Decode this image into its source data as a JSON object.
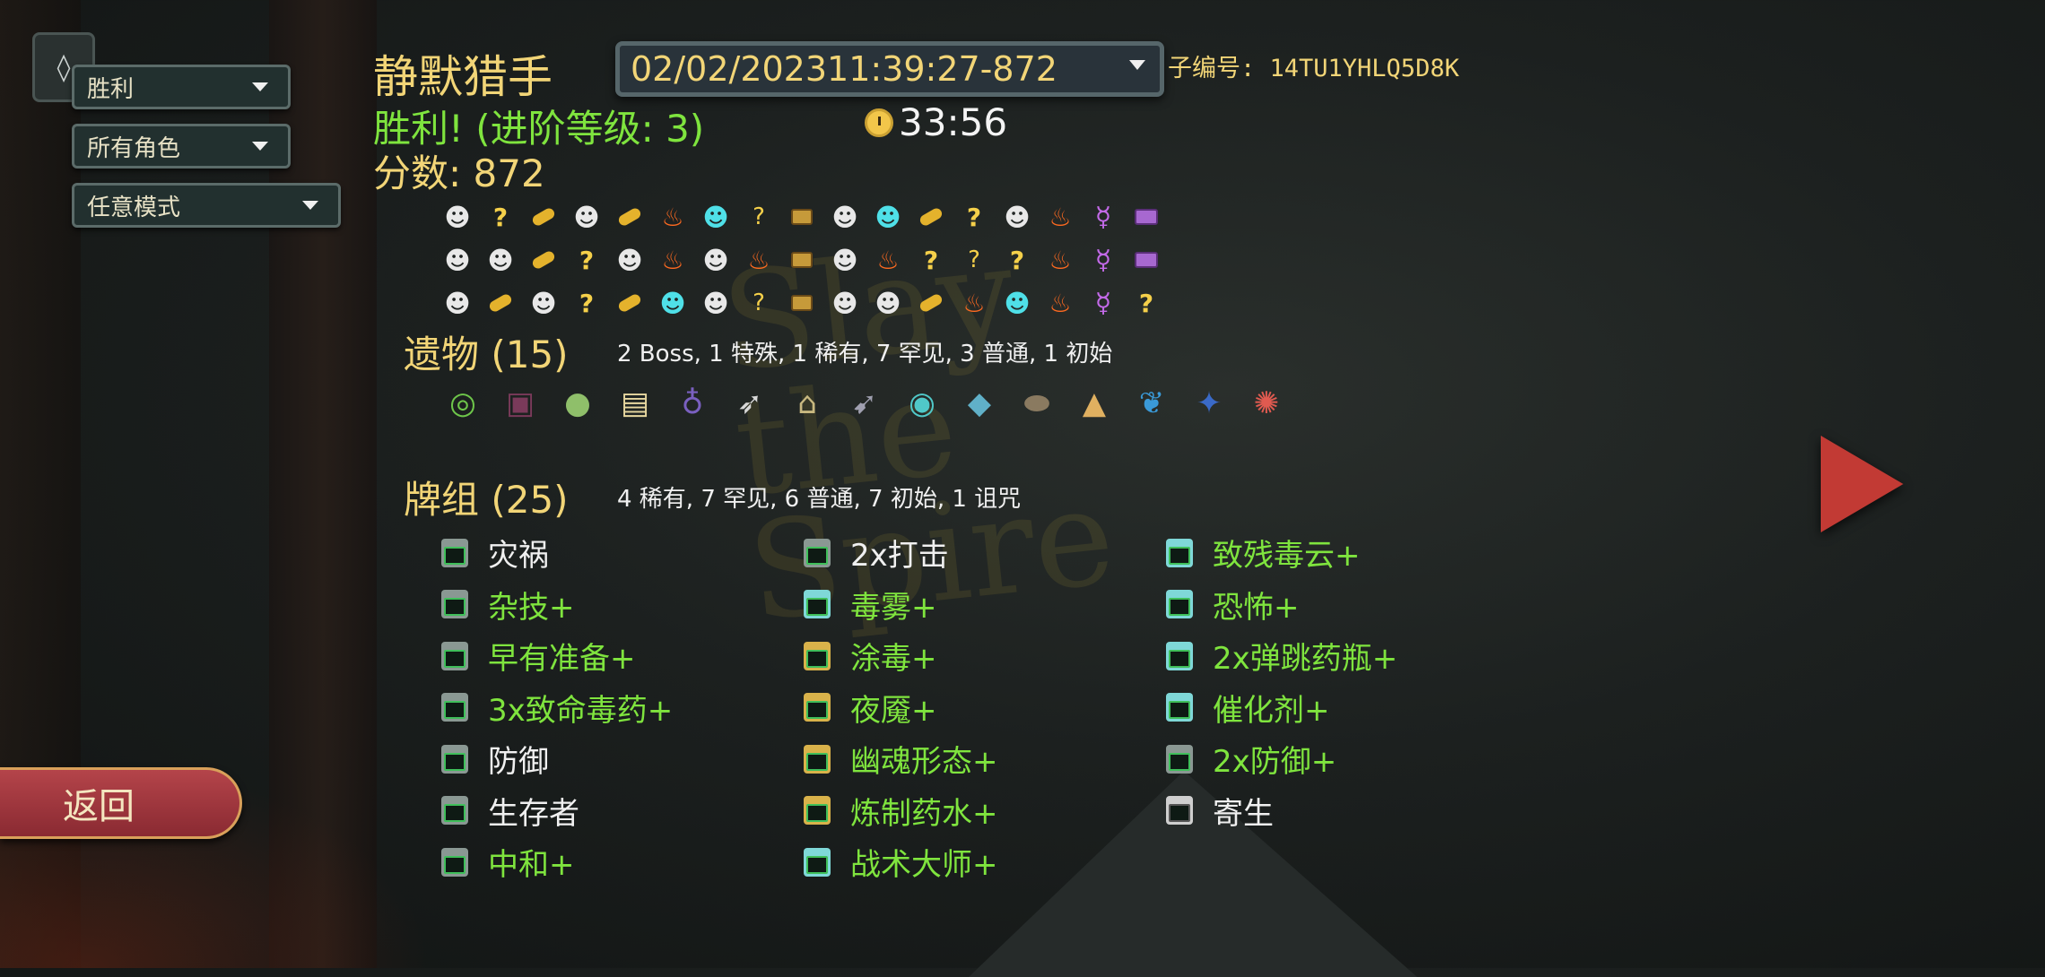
{
  "filters": {
    "result": "胜利",
    "character": "所有角色",
    "mode": "任意模式"
  },
  "run": {
    "character_name": "静默猎手",
    "selected_run": "02/02/202311:39:27-872",
    "seed_label": "子编号: 14TU1YHLQ5D8K",
    "result_line": "胜利! (进阶等级: 3)",
    "play_time": "33:56",
    "score_line": "分数: 872"
  },
  "path_rows": [
    [
      "monster",
      "unknown",
      "rest",
      "monster",
      "rest",
      "fire",
      "elite",
      "mixed",
      "chest",
      "monster",
      "elite",
      "rest",
      "unknown",
      "monster",
      "fire",
      "boss",
      "chest-boss"
    ],
    [
      "monster",
      "monster",
      "rest",
      "unknown",
      "monster",
      "fire",
      "monster",
      "fire",
      "chest",
      "monster",
      "fire",
      "unknown",
      "mixed",
      "unknown",
      "fire",
      "boss",
      "chest-boss"
    ],
    [
      "monster",
      "rest",
      "monster",
      "unknown",
      "rest",
      "elite",
      "monster",
      "mixed",
      "chest",
      "monster",
      "monster",
      "rest",
      "fire",
      "elite",
      "fire",
      "boss",
      "unknown"
    ]
  ],
  "relics_section": {
    "title": "遗物 (15)",
    "summary": "2  Boss, 1  特殊, 1  稀有, 7  罕见, 3  普通, 1  初始",
    "items": [
      {
        "icon": "ring-snake-icon",
        "color": "#6ec64a",
        "glyph": "◎"
      },
      {
        "icon": "runic-pyramid-box-icon",
        "color": "#7a3a5a",
        "glyph": "▣"
      },
      {
        "icon": "egg-icon",
        "color": "#8fbf6a",
        "glyph": "●"
      },
      {
        "icon": "scroll-icon",
        "color": "#e8d8a0",
        "glyph": "▤"
      },
      {
        "icon": "potion-bag-icon",
        "color": "#7a60c0",
        "glyph": "♁"
      },
      {
        "icon": "bird-skull-icon",
        "color": "#d8d8d8",
        "glyph": "➶"
      },
      {
        "icon": "bird-cage-icon",
        "color": "#c8b880",
        "glyph": "⌂"
      },
      {
        "icon": "kunai-icon",
        "color": "#a0a0b0",
        "glyph": "➹"
      },
      {
        "icon": "spool-icon",
        "color": "#50c8c8",
        "glyph": "◉"
      },
      {
        "icon": "crystal-icon",
        "color": "#60b0c8",
        "glyph": "◆"
      },
      {
        "icon": "stone-egg-icon",
        "color": "#8a7a60",
        "glyph": "⬬"
      },
      {
        "icon": "pyramid-icon",
        "color": "#e0b060",
        "glyph": "▲"
      },
      {
        "icon": "feather-icon",
        "color": "#3a9ad8",
        "glyph": "❦"
      },
      {
        "icon": "toy-monster-icon",
        "color": "#3a6ac8",
        "glyph": "✦"
      },
      {
        "icon": "dragon-claw-icon",
        "color": "#e05a50",
        "glyph": "✺"
      }
    ]
  },
  "deck_section": {
    "title": "牌组 (25)",
    "summary": "4  稀有, 7  罕见, 6  普通, 7  初始, 1  诅咒",
    "columns": [
      [
        {
          "name": "灾祸",
          "upgraded": false,
          "frame": "gray"
        },
        {
          "name": "杂技+",
          "upgraded": true,
          "frame": "gray"
        },
        {
          "name": "早有准备+",
          "upgraded": true,
          "frame": "gray"
        },
        {
          "name": "3x致命毒药+",
          "upgraded": true,
          "frame": "gray"
        },
        {
          "name": "防御",
          "upgraded": false,
          "frame": "gray"
        },
        {
          "name": "生存者",
          "upgraded": false,
          "frame": "gray"
        },
        {
          "name": "中和+",
          "upgraded": true,
          "frame": "gray"
        }
      ],
      [
        {
          "name": "2x打击",
          "upgraded": false,
          "frame": "gray"
        },
        {
          "name": "毒雾+",
          "upgraded": true,
          "frame": "teal"
        },
        {
          "name": "涂毒+",
          "upgraded": true,
          "frame": "gold"
        },
        {
          "name": "夜魇+",
          "upgraded": true,
          "frame": "gold"
        },
        {
          "name": "幽魂形态+",
          "upgraded": true,
          "frame": "gold"
        },
        {
          "name": "炼制药水+",
          "upgraded": true,
          "frame": "gold"
        },
        {
          "name": "战术大师+",
          "upgraded": true,
          "frame": "teal"
        }
      ],
      [
        {
          "name": "致残毒云+",
          "upgraded": true,
          "frame": "teal"
        },
        {
          "name": "恐怖+",
          "upgraded": true,
          "frame": "teal"
        },
        {
          "name": "2x弹跳药瓶+",
          "upgraded": true,
          "frame": "teal"
        },
        {
          "name": "催化剂+",
          "upgraded": true,
          "frame": "teal"
        },
        {
          "name": "2x防御+",
          "upgraded": true,
          "frame": "gray"
        },
        {
          "name": "寄生",
          "upgraded": false,
          "frame": "dark"
        }
      ]
    ]
  },
  "nav": {
    "back_label": "返回"
  }
}
